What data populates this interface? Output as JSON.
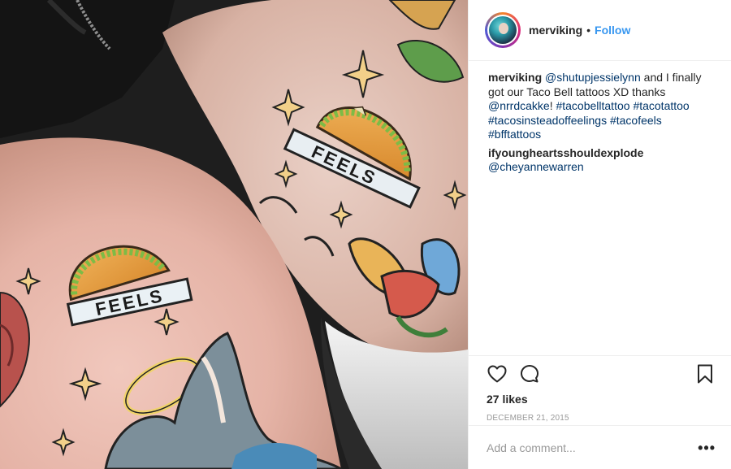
{
  "header": {
    "username": "merviking",
    "separator": "•",
    "follow_label": "Follow"
  },
  "caption": {
    "username": "merviking",
    "mention_1": "@shutupjessielynn",
    "text_1": " and I finally got our Taco Bell tattoos XD thanks ",
    "mention_2": "@nrrdcakke",
    "text_2": "! ",
    "hashtags": [
      "#tacobelltattoo",
      "#tacotattoo",
      "#tacosinsteadoffeelings",
      "#tacofeels",
      "#bfftattoos"
    ]
  },
  "reply": {
    "username": "ifyoungheartsshouldexplode",
    "mention": "@cheyannewarren"
  },
  "photo": {
    "tattoo_text": "FEELS",
    "alt": "Two matching taco tattoos"
  },
  "icons": {
    "like": "heart-icon",
    "comment": "comment-bubble-icon",
    "save": "bookmark-icon",
    "more": "more-options-icon"
  },
  "stats": {
    "likes": "27 likes",
    "date": "DECEMBER 21, 2015"
  },
  "add_comment": {
    "placeholder": "Add a comment...",
    "more_label": "•••"
  }
}
